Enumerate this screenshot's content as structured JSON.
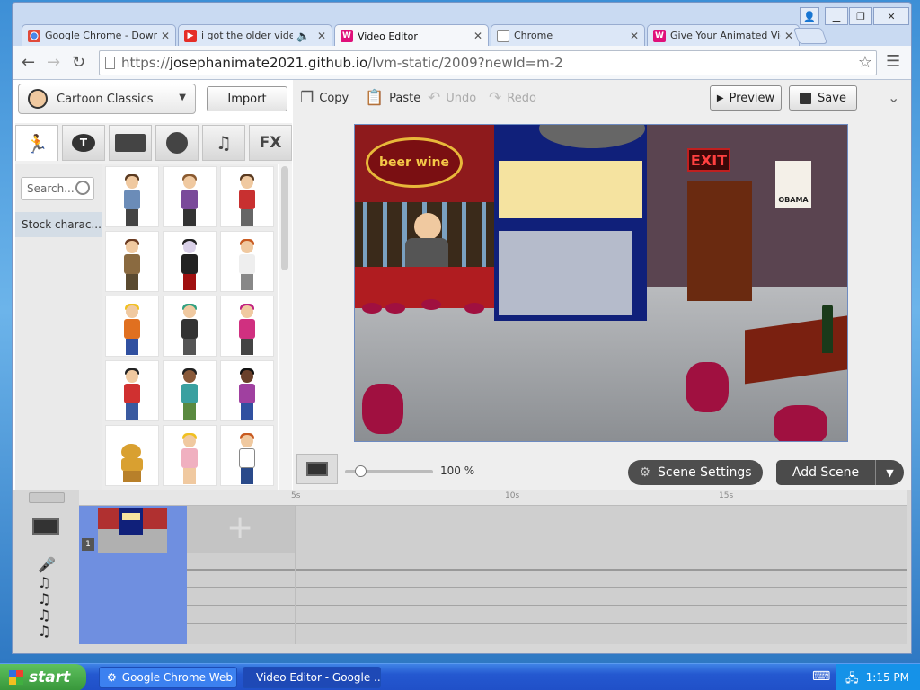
{
  "browser": {
    "tabs": [
      {
        "title": "Google Chrome - Downlo",
        "favicon": "chrome-icon"
      },
      {
        "title": "i got the older videom",
        "favicon": "youtube-icon"
      },
      {
        "title": "Video Editor",
        "favicon": "wixie-icon"
      },
      {
        "title": "Chrome",
        "favicon": "document-icon"
      },
      {
        "title": "Give Your Animated Vide",
        "favicon": "wixie-icon"
      }
    ],
    "active_tab": 2,
    "url_scheme": "https://",
    "url_domain": "josephanimate2021.github.io",
    "url_path": "/lvm-static/2009?newId=m-2"
  },
  "editor": {
    "theme_name": "Cartoon Classics",
    "import_label": "Import",
    "category_tabs": [
      "character-tab",
      "text-bubble-tab",
      "background-tab",
      "props-tab",
      "music-tab",
      "effects-tab"
    ],
    "fx_label": "FX",
    "search_placeholder": "Search...",
    "stock_label": "Stock charac...",
    "toolbar": {
      "copy": "Copy",
      "paste": "Paste",
      "undo": "Undo",
      "redo": "Redo",
      "preview": "Preview",
      "save": "Save"
    },
    "zoom": "100 %",
    "scene_settings": "Scene Settings",
    "add_scene": "Add Scene",
    "stage_signs": {
      "bar_sign": "beer wine",
      "exit_sign": "EXIT",
      "poster": "OBAMA"
    }
  },
  "timeline": {
    "labels": [
      "5s",
      "10s",
      "15s"
    ],
    "scene_number": "1"
  },
  "taskbar": {
    "start": "start",
    "tasks": [
      "Google Chrome Web ...",
      "Video Editor - Google ..."
    ],
    "clock": "1:15 PM"
  }
}
